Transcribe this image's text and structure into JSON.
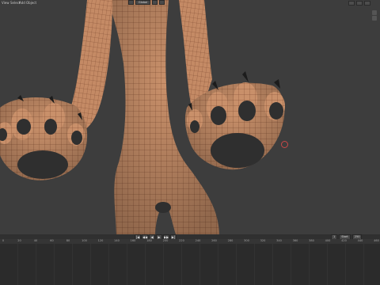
{
  "viewport": {
    "menu": [
      "View",
      "Select",
      "Add",
      "Object"
    ],
    "mode_label": "Global",
    "background": "#3d3d3d",
    "mesh_color": "#c9906a",
    "wire_color": "#6b3a22",
    "pad_color": "#2f2f2f",
    "cursor_color": "#c84848"
  },
  "timeline": {
    "playback_buttons": [
      "|◀",
      "◀◀",
      "◀",
      "▶",
      "▶▶",
      "▶|"
    ],
    "frame_fields": [
      "1",
      "Start",
      "250"
    ],
    "ruler_ticks": [
      "0",
      "20",
      "40",
      "60",
      "80",
      "100",
      "120",
      "140",
      "160",
      "180",
      "200",
      "220",
      "240",
      "260",
      "280",
      "300",
      "320",
      "340",
      "360",
      "380",
      "400",
      "420",
      "440",
      "460"
    ]
  }
}
